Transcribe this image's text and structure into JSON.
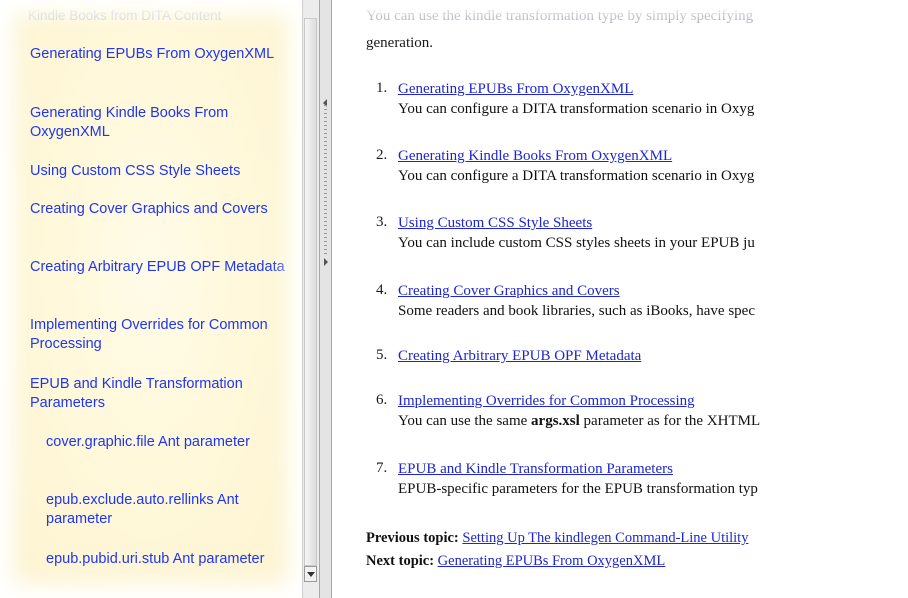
{
  "nav": {
    "header": "Kindle Books from DITA Content",
    "items": [
      {
        "label": "Generating EPUBs From OxygenXML",
        "sub": false
      },
      {
        "label": "Generating Kindle Books From OxygenXML",
        "sub": false
      },
      {
        "label": "Using Custom CSS Style Sheets",
        "sub": false
      },
      {
        "label": "Creating Cover Graphics and Covers",
        "sub": false
      },
      {
        "label": "Creating Arbitrary EPUB OPF Metadata",
        "sub": false
      },
      {
        "label": "Implementing Overrides for Common Processing",
        "sub": false
      },
      {
        "label": "EPUB and Kindle Transformation Parameters",
        "sub": false
      },
      {
        "label": "cover.graphic.file Ant parameter",
        "sub": true
      },
      {
        "label": "epub.exclude.auto.rellinks Ant parameter",
        "sub": true
      },
      {
        "label": "epub.pubid.uri.stub Ant parameter",
        "sub": true
      }
    ]
  },
  "content": {
    "intro_faded": "You can use the kindle transformation type by simply specifying",
    "intro_end": "generation.",
    "topics": [
      {
        "num": "1.",
        "link": "Generating EPUBs From OxygenXML",
        "desc": "You can configure a DITA transformation scenario in Oxyg"
      },
      {
        "num": "2.",
        "link": "Generating Kindle Books From OxygenXML",
        "desc": "You can configure a DITA transformation scenario in Oxyg"
      },
      {
        "num": "3.",
        "link": "Using Custom CSS Style Sheets",
        "desc": "You can include custom CSS styles sheets in your EPUB ju"
      },
      {
        "num": "4.",
        "link": "Creating Cover Graphics and Covers",
        "desc": "Some readers and book libraries, such as iBooks, have spec"
      },
      {
        "num": "5.",
        "link": "Creating Arbitrary EPUB OPF Metadata",
        "desc": ""
      },
      {
        "num": "6.",
        "link": "Implementing Overrides for Common Processing",
        "desc_before": "You can use the same ",
        "desc_code": "args.xsl",
        "desc_after": " parameter as for the XHTML"
      },
      {
        "num": "7.",
        "link": "EPUB and Kindle Transformation Parameters",
        "desc": "EPUB-specific parameters for the EPUB transformation typ"
      }
    ],
    "previous_label": "Previous topic:",
    "previous_link": "Setting Up The kindlegen Command-Line Utility",
    "next_label": "Next topic:",
    "next_link": "Generating EPUBs From OxygenXML"
  }
}
